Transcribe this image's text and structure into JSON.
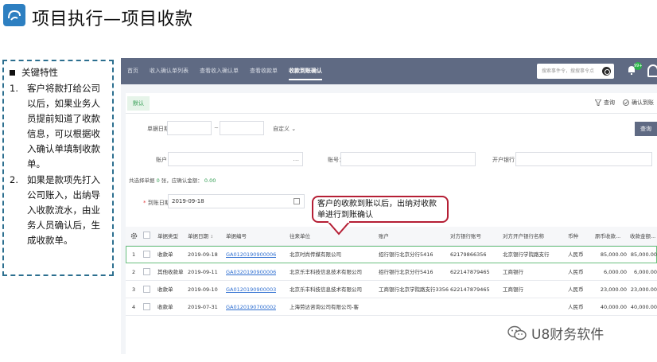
{
  "slide": {
    "title": "项目执行—项目收款"
  },
  "note": {
    "heading": "关键特性",
    "items": [
      {
        "num": "1.",
        "text": "客户将款打给公司以后，如果业务人员提前知道了收款信息，可以根据收入确认单填制收款单。"
      },
      {
        "num": "2.",
        "text": "如果是款项先打入公司账入，出纳导入收款流水，由业务人员确认后，生成收款单。"
      }
    ]
  },
  "app": {
    "nav": [
      "首页",
      "收入确认单列表",
      "查看收入确认单",
      "查看收款单",
      "收款到账确认"
    ],
    "active_nav": "收款到账确认",
    "search_placeholder": "搜索事件令，搜搜事令点",
    "badge_count": "99+",
    "tab": "默认",
    "actions": {
      "view": "查询",
      "confirm": "确认到账"
    },
    "filters": {
      "date_label": "单据日期：",
      "tilde": "~",
      "custom": "自定义",
      "query_button": "查询",
      "account_label": "账户：",
      "account_dots": "...",
      "acct_no_label": "账号：",
      "bank_label": "开户银行："
    },
    "summary": {
      "prefix": "共选择单据",
      "count": "0",
      "mid": "张，应确认金额：",
      "amount": "0.00"
    },
    "arrival_date": {
      "label": "到账日期：",
      "value": "2019-09-18"
    },
    "table": {
      "columns": [
        "单据类型",
        "单据日期",
        "单据编号",
        "往来单位",
        "账户",
        "对方银行账号",
        "对方开户银行名称",
        "币种",
        "原币收款...",
        "收款金额..."
      ],
      "rows": [
        [
          "1",
          "收款单",
          "2019-09-18",
          "GA0120190900006",
          "北京时尚传媒有限公司",
          "招行银行北京分行5416",
          "62179866356",
          "北京银行学院路支行",
          "人民币",
          "85,000.00",
          "85,000.00"
        ],
        [
          "2",
          "其他收款单",
          "2019-09-11",
          "GA0320190900006",
          "北京乐丰科技信息技术有限公司",
          "招行银行北京分行5416",
          "622147879465",
          "工商银行",
          "人民币",
          "6,000.00",
          "6,000.00"
        ],
        [
          "3",
          "收款单",
          "2019-09-10",
          "GA0120190900003",
          "北京乐丰科技信息技术有限公司",
          "工商银行北京学院路支行3356",
          "622147879465",
          "工商银行",
          "人民币",
          "23,000.00",
          "23,000.00"
        ],
        [
          "4",
          "收款单",
          "2019-07-31",
          "GA0120190700002",
          "上海劳达咨询公司有限公司-客",
          "",
          "",
          "",
          "人民币",
          "40,000.00",
          "40,000.00"
        ]
      ]
    }
  },
  "callout": {
    "text": "客户的收款到账以后，出纳对收款单进行到账确认"
  },
  "watermark": {
    "text": "U8财务软件"
  },
  "colors": {
    "topbar": "#5f6a83",
    "accent_green": "#2e9b4f",
    "link_blue": "#2f6fd1",
    "callout_border": "#b51f35",
    "note_border": "#2c6f8f"
  }
}
